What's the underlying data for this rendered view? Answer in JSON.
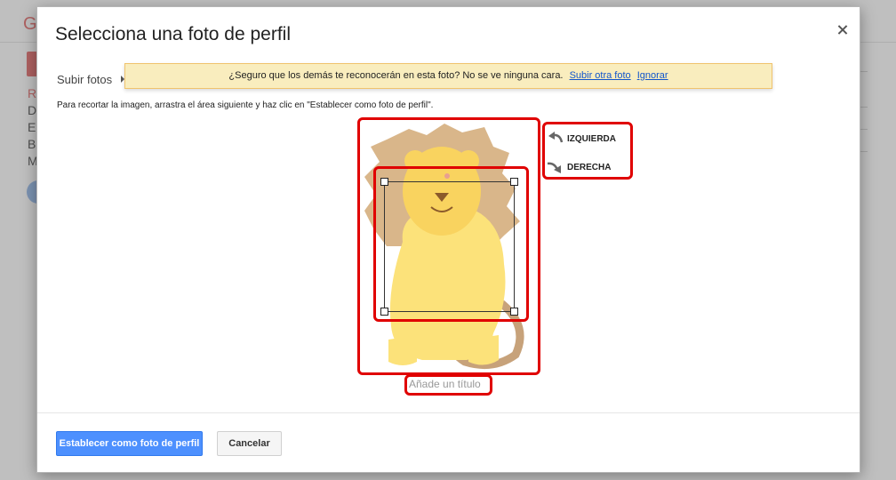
{
  "background": {
    "logo_letter": "G",
    "nav_items": [
      "R",
      "D",
      "E",
      "B",
      "M"
    ]
  },
  "dialog": {
    "title": "Selecciona una foto de perfil",
    "tab_label": "Subir fotos",
    "warning": {
      "message": "¿Seguro que los demás te reconocerán en esta foto? No se ve ninguna cara.",
      "link_upload_other": "Subir otra foto",
      "link_ignore": "Ignorar"
    },
    "instructions": "Para recortar la imagen, arrastra el área siguiente y haz clic en \"Establecer como foto de perfil\".",
    "rotate_left_label": "IZQUIERDA",
    "rotate_right_label": "DERECHA",
    "caption_placeholder": "Añade un título",
    "set_profile_button": "Establecer como foto de perfil",
    "cancel_button": "Cancelar"
  },
  "icons": {
    "close": "close-icon",
    "rotate_left": "rotate-left-icon",
    "rotate_right": "rotate-right-icon",
    "tab_arrow": "caret-right-icon"
  },
  "colors": {
    "primary_button": "#4d90fe",
    "warning_bg": "#f9edbe",
    "highlight": "#e00000",
    "link": "#1155cc"
  }
}
